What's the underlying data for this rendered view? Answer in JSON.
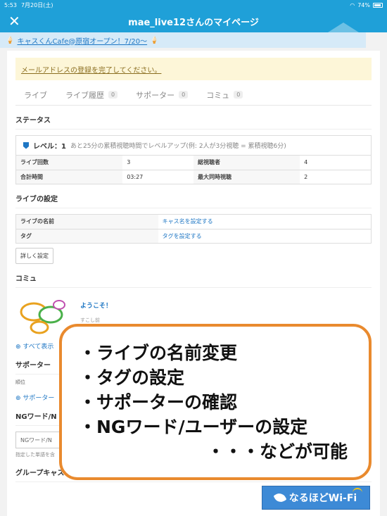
{
  "status_bar": {
    "time": "5:53",
    "date": "7月20日(土)",
    "battery": "74%",
    "battery_level": 0.74
  },
  "nav": {
    "close": "✕",
    "title": "mae_live12さんのマイページ"
  },
  "banner": {
    "text": "キャスくんCafe@原宿オープン！7/20〜"
  },
  "notice": "メールアドレスの登録を完了してください。",
  "tabs": [
    {
      "label": "ライブ",
      "count": ""
    },
    {
      "label": "ライブ履歴",
      "count": "0"
    },
    {
      "label": "サポーター",
      "count": "0"
    },
    {
      "label": "コミュ",
      "count": "0"
    }
  ],
  "status": {
    "heading": "ステータス",
    "level": "レベル：1",
    "level_note": "あと25分の累積視聴時間でレベルアップ(例: 2人が3分視聴 = 累積視聴6分)",
    "rows": [
      {
        "l1": "ライブ回数",
        "v1": "3",
        "l2": "総視聴者",
        "v2": "4"
      },
      {
        "l1": "合計時間",
        "v1": "03:27",
        "l2": "最大同時視聴",
        "v2": "2"
      }
    ]
  },
  "live_settings": {
    "heading": "ライブの設定",
    "name_label": "ライブの名前",
    "name_link": "キャス名を設定する",
    "tag_label": "タグ",
    "tag_link": "タグを設定する",
    "detail_button": "詳しく設定"
  },
  "community": {
    "heading": "コミュ",
    "welcome": "ようこそ！",
    "time": "すこし前",
    "more": "すべて表示"
  },
  "supporter": {
    "heading": "サポーター",
    "rank_label": "順位",
    "link": "サポーター"
  },
  "ngword": {
    "heading": "NGワード/N",
    "placeholder": "NGワード/N",
    "note": "指定した単語を含"
  },
  "group": {
    "heading": "グループキャス"
  },
  "overlay": {
    "lines": [
      "・ライブの名前変更",
      "・タグの設定",
      "・サポーターの確認",
      "・NGワード/ユーザーの設定"
    ],
    "last": "・・・などが可能"
  },
  "logo": {
    "text": "なるほどWi-Fi"
  },
  "colors": {
    "accent": "#1fa0d8",
    "link": "#1f77c4",
    "overlay_border": "#e98a2e"
  }
}
